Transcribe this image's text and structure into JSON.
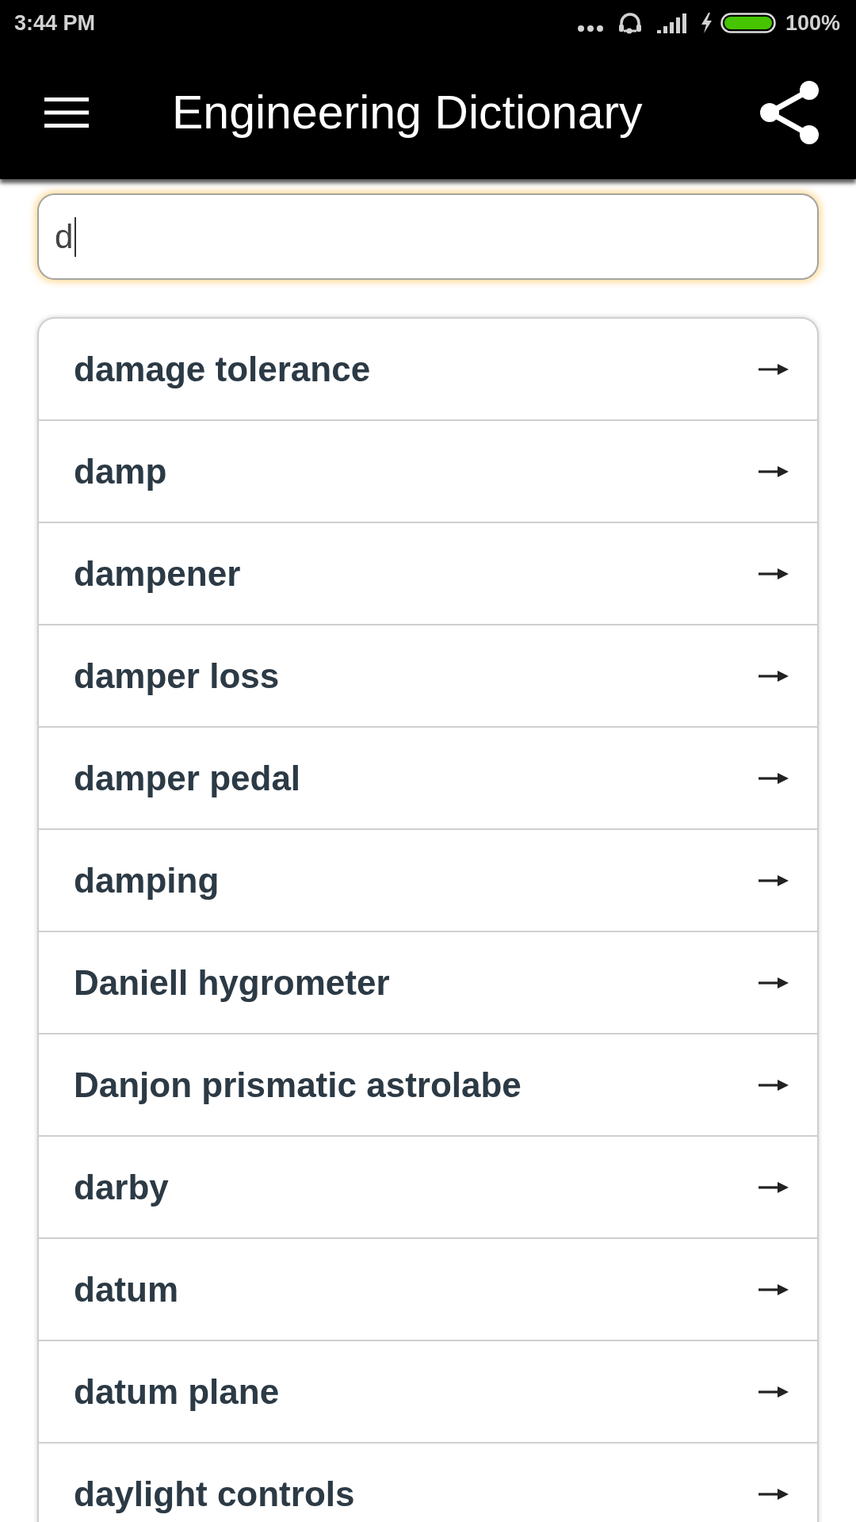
{
  "status_bar": {
    "time": "3:44 PM",
    "battery": "100%"
  },
  "app_bar": {
    "title": "Engineering Dictionary"
  },
  "search": {
    "value": "d",
    "focused": true
  },
  "results": [
    {
      "term": "damage tolerance"
    },
    {
      "term": "damp"
    },
    {
      "term": "dampener"
    },
    {
      "term": "damper loss"
    },
    {
      "term": "damper pedal"
    },
    {
      "term": "damping"
    },
    {
      "term": "Daniell hygrometer"
    },
    {
      "term": "Danjon prismatic astrolabe"
    },
    {
      "term": "darby"
    },
    {
      "term": "datum"
    },
    {
      "term": "datum plane"
    },
    {
      "term": "daylight controls"
    }
  ]
}
